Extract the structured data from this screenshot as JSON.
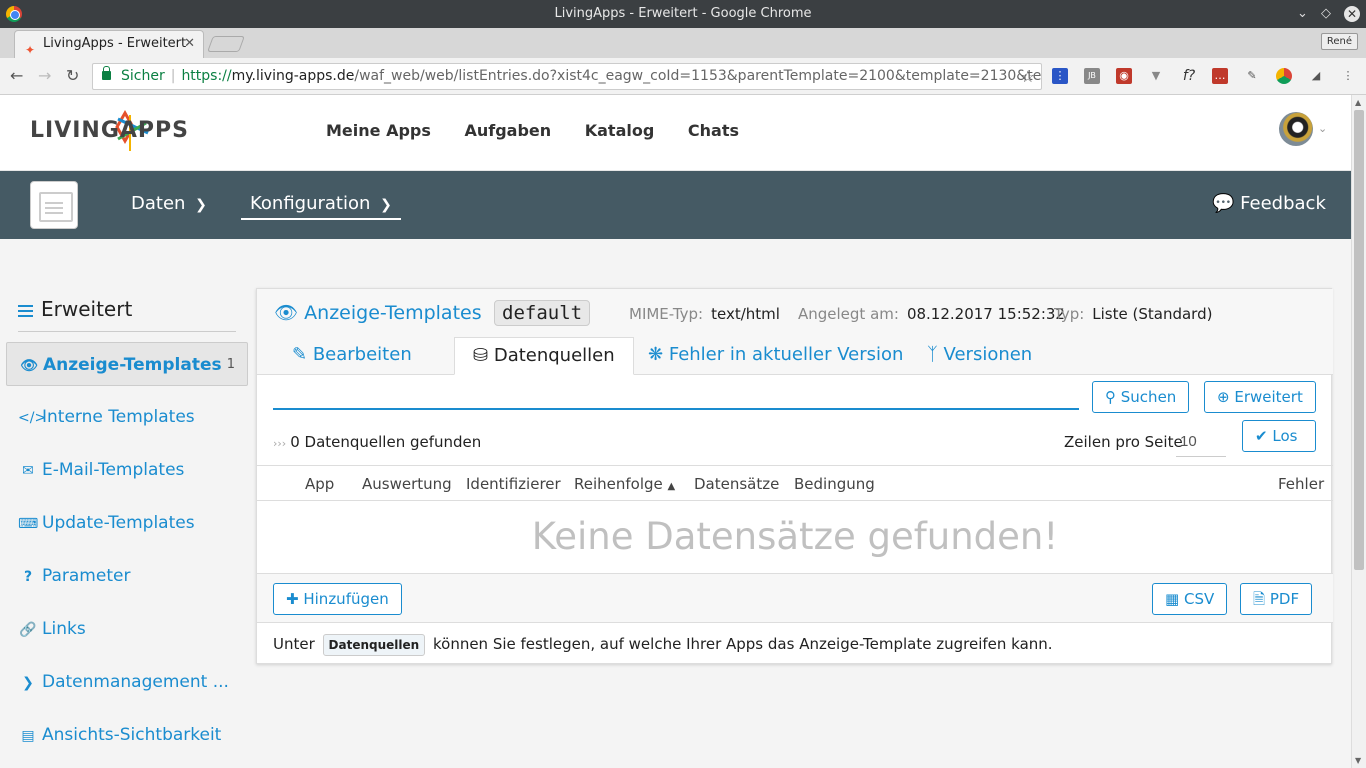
{
  "window": {
    "title": "LivingApps - Erweitert - Google Chrome",
    "profile": "René"
  },
  "browser": {
    "tab_title": "LivingApps - Erweitert",
    "secure_label": "Sicher",
    "url_scheme": "https://",
    "url_host": "my.living-apps.de",
    "url_path": "/waf_web/web/listEntries.do?xist4c_eagw_coId=1153&parentTemplate=2100&template=2130&te..."
  },
  "topnav": {
    "logo_text": "LIVINGAPPS",
    "items": [
      "Meine Apps",
      "Aufgaben",
      "Katalog",
      "Chats"
    ]
  },
  "appbar": {
    "menus": [
      "Daten",
      "Konfiguration"
    ],
    "feedback": "Feedback"
  },
  "sidebar": {
    "title": "Erweitert",
    "items": [
      {
        "label": "Anzeige-Templates",
        "icon": "eye-icon",
        "count": "1"
      },
      {
        "label": "Interne Templates",
        "icon": "code-icon"
      },
      {
        "label": "E-Mail-Templates",
        "icon": "envelope-icon"
      },
      {
        "label": "Update-Templates",
        "icon": "keyboard-icon"
      },
      {
        "label": "Parameter",
        "icon": "question-icon"
      },
      {
        "label": "Links",
        "icon": "link-icon"
      },
      {
        "label": "Datenmanagement ...",
        "icon": "chevron-right-icon"
      },
      {
        "label": "Ansichts-Sichtbarkeit",
        "icon": "list-alt-icon"
      }
    ]
  },
  "card": {
    "title": "Anzeige-Templates",
    "identifier": "default",
    "mime_label": "MIME-Typ:",
    "mime_value": "text/html",
    "created_label": "Angelegt am:",
    "created_value": "08.12.2017 15:52:32",
    "type_label": "Typ:",
    "type_value": "Liste (Standard)",
    "tabs": [
      "Bearbeiten",
      "Datenquellen",
      "Fehler in aktueller Version",
      "Versionen"
    ],
    "active_tab": "Datenquellen",
    "search_value": "",
    "search_button": "Suchen",
    "advanced_button": "Erweitert",
    "found_text": "0 Datenquellen gefunden",
    "rows_per_page_label": "Zeilen pro Seite",
    "rows_per_page_value": "10",
    "go_button": "Los",
    "columns": [
      "App",
      "Auswertung",
      "Identifizierer",
      "Reihenfolge",
      "Datensätze",
      "Bedingung",
      "Fehler"
    ],
    "empty_text": "Keine Datensätze gefunden!",
    "add_button": "Hinzufügen",
    "csv_button": "CSV",
    "pdf_button": "PDF",
    "note_before": "Unter",
    "note_kbd": "Datenquellen",
    "note_after": "können Sie festlegen, auf welche Ihrer Apps das Anzeige-Template zugreifen kann."
  },
  "colors": {
    "accent": "#1a8ccf",
    "appbar": "#455a64"
  }
}
